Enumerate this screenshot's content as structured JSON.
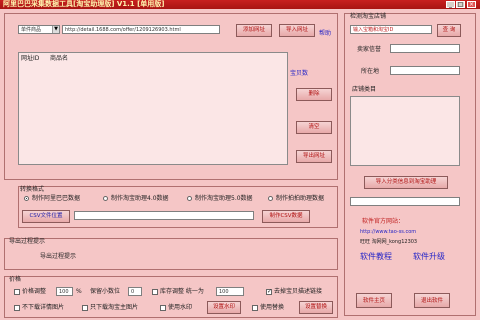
{
  "window": {
    "title": "阿里巴巴采集数据工具[淘宝助理版] V1.1 [单用版]",
    "min_label": "_",
    "max_label": "□",
    "close_label": "×"
  },
  "import_bar": {
    "type_value": "单件商品",
    "url_value": "http://detail.1688.com/offer/1209126903.html",
    "add_button": "添加网址",
    "import_button": "导入网址",
    "help_link": "帮助"
  },
  "list": {
    "headers": [
      "网址ID",
      "商品名"
    ],
    "side_link": "宝贝数",
    "delete_button": "删除",
    "clear_button": "清空",
    "export_button": "导出网址"
  },
  "convert": {
    "title": "转换格式",
    "options": [
      "制作阿里巴巴数据",
      "制作淘宝助理4.0数据",
      "制作淘宝助理5.0数据",
      "制作拍拍助理数据"
    ],
    "selected_index": 0,
    "folder_button": "CSV文件位置",
    "make_button": "制作CSV数据"
  },
  "export_prompt": {
    "title": "导出过程提示",
    "message": "导出过程提示"
  },
  "settings": {
    "title": "价格",
    "price_label": "价格调整",
    "price_value": "100",
    "price_unit": "%",
    "decimal_label": "保留小数位",
    "decimal_value": "0",
    "stock_label": "库存调整 统一为",
    "stock_value": "100",
    "remove_link_label": "去掉宝贝描述链接",
    "no_image_label": "不下载详情图片",
    "only_main_image_label": "只下载淘宝主图片",
    "watermark_label": "使用水印",
    "watermark_button": "设置水印",
    "replace_label": "使用替换",
    "replace_button": "设置替换"
  },
  "shop": {
    "title": "检测淘宝店铺",
    "login_label": "输入宝箱和淘宝ID",
    "query_button": "查 询",
    "credit_label": "卖家信誉",
    "location_label": "所在地",
    "categories_label": "店铺类目",
    "import_button": "导入分类信息到淘宝助理",
    "site_label": "软件官方网站：",
    "site_url": "http://www.tao-ss.com",
    "contact": "旺旺 淘网网_kong12303",
    "tutorial_link": "软件教程",
    "upgrade_link": "软件升级",
    "sites_button": "软件主页",
    "exit_button": "退出软件"
  },
  "colors": {
    "title_bar": "#b81a18",
    "panel_bg": "#f5c6c6",
    "button_text": "#b01010",
    "link": "#2626c8"
  }
}
